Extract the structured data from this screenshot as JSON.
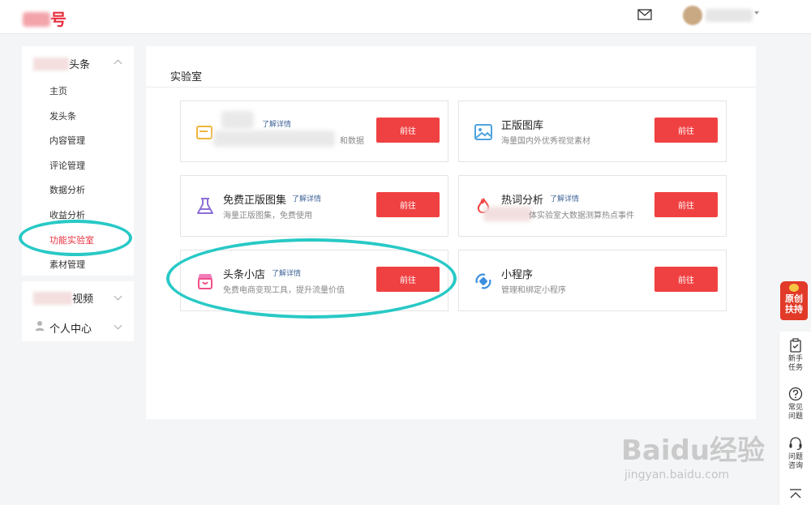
{
  "header": {
    "logo_text": "号"
  },
  "sidebar": {
    "group1": {
      "label": "头条",
      "items": [
        {
          "label": "主页"
        },
        {
          "label": "发头条"
        },
        {
          "label": "内容管理"
        },
        {
          "label": "评论管理"
        },
        {
          "label": "数据分析"
        },
        {
          "label": "收益分析"
        },
        {
          "label": "功能实验室"
        },
        {
          "label": "素材管理"
        }
      ],
      "active_item": "功能实验室"
    },
    "group2": {
      "label": "视频"
    },
    "group3": {
      "label": "个人中心"
    }
  },
  "main": {
    "title": "实验室",
    "cards": [
      {
        "title": "",
        "detail": "了解详情",
        "desc": "和数据",
        "button": "前往"
      },
      {
        "title": "正版图库",
        "detail": "",
        "desc": "海量国内外优秀视觉素材",
        "button": "前往"
      },
      {
        "title": "免费正版图集",
        "detail": "了解详情",
        "desc": "海量正版图集，免费使用",
        "button": "前往"
      },
      {
        "title": "热词分析",
        "detail": "了解详情",
        "desc": "体实验室大数据测算热点事件",
        "button": "前往"
      },
      {
        "title": "头条小店",
        "detail": "了解详情",
        "desc": "免费电商变现工具，提升流量价值",
        "button": "前往"
      },
      {
        "title": "小程序",
        "detail": "",
        "desc": "管理和绑定小程序",
        "button": "前往"
      }
    ]
  },
  "float": {
    "badge_line1": "原创",
    "badge_line2": "扶持",
    "tools": [
      {
        "line1": "新手",
        "line2": "任务",
        "icon": "clipboard-icon"
      },
      {
        "line1": "常见",
        "line2": "问题",
        "icon": "question-icon"
      },
      {
        "line1": "问题",
        "line2": "咨询",
        "icon": "headset-icon"
      }
    ]
  },
  "watermark": {
    "main": "Baidu经验",
    "sub": "jingyan.baidu.com"
  },
  "colors": {
    "accent": "#f04142",
    "highlight_ring": "#28c9c6",
    "link": "#406599"
  }
}
